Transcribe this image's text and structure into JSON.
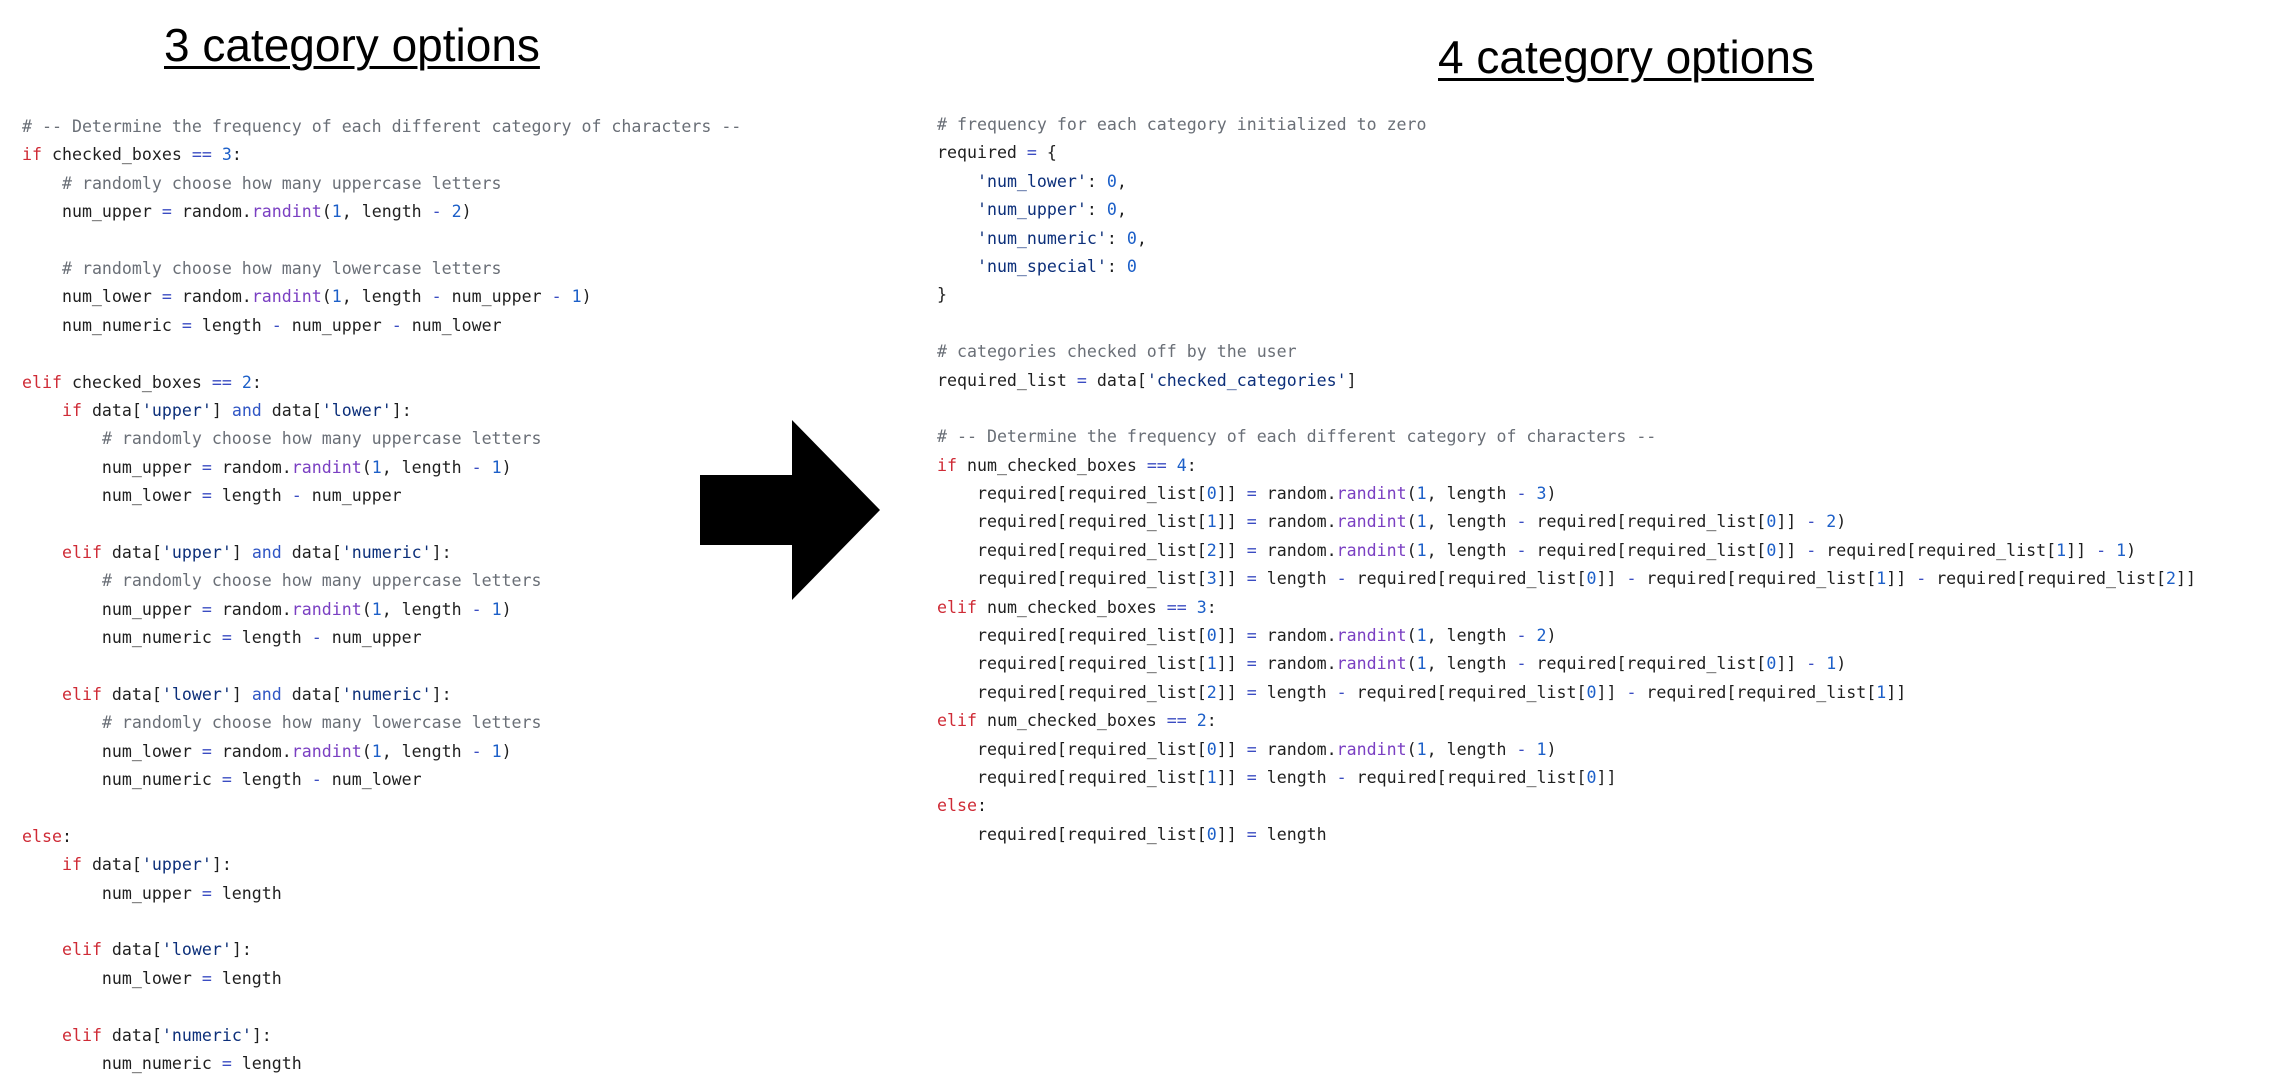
{
  "headings": {
    "left": "3 category options",
    "right": "4 category options"
  },
  "colors": {
    "comment": "#6a6f77",
    "keyword": "#cf2b36",
    "keyword2": "#2f55c4",
    "func": "#7a3fc2",
    "number": "#1c5fc8",
    "string": "#0c2f7a",
    "op": "#3a4cc2",
    "plain": "#1f1f1f",
    "arrow": "#000000"
  },
  "arrow": {
    "icon": "right-arrow-icon"
  },
  "code_left": [
    [
      [
        "c",
        "# -- Determine the frequency of each different category of characters --"
      ]
    ],
    [
      [
        "k",
        "if"
      ],
      [
        "p",
        " checked_boxes "
      ],
      [
        "o",
        "=="
      ],
      [
        "p",
        " "
      ],
      [
        "n",
        "3"
      ],
      [
        "p",
        ":"
      ]
    ],
    [
      [
        "p",
        "    "
      ],
      [
        "c",
        "# randomly choose how many uppercase letters"
      ]
    ],
    [
      [
        "p",
        "    num_upper "
      ],
      [
        "o",
        "="
      ],
      [
        "p",
        " random."
      ],
      [
        "f",
        "randint"
      ],
      [
        "p",
        "("
      ],
      [
        "n",
        "1"
      ],
      [
        "p",
        ", length "
      ],
      [
        "o",
        "-"
      ],
      [
        "p",
        " "
      ],
      [
        "n",
        "2"
      ],
      [
        "p",
        ")"
      ]
    ],
    [],
    [
      [
        "p",
        "    "
      ],
      [
        "c",
        "# randomly choose how many lowercase letters"
      ]
    ],
    [
      [
        "p",
        "    num_lower "
      ],
      [
        "o",
        "="
      ],
      [
        "p",
        " random."
      ],
      [
        "f",
        "randint"
      ],
      [
        "p",
        "("
      ],
      [
        "n",
        "1"
      ],
      [
        "p",
        ", length "
      ],
      [
        "o",
        "-"
      ],
      [
        "p",
        " num_upper "
      ],
      [
        "o",
        "-"
      ],
      [
        "p",
        " "
      ],
      [
        "n",
        "1"
      ],
      [
        "p",
        ")"
      ]
    ],
    [
      [
        "p",
        "    num_numeric "
      ],
      [
        "o",
        "="
      ],
      [
        "p",
        " length "
      ],
      [
        "o",
        "-"
      ],
      [
        "p",
        " num_upper "
      ],
      [
        "o",
        "-"
      ],
      [
        "p",
        " num_lower"
      ]
    ],
    [],
    [
      [
        "k",
        "elif"
      ],
      [
        "p",
        " checked_boxes "
      ],
      [
        "o",
        "=="
      ],
      [
        "p",
        " "
      ],
      [
        "n",
        "2"
      ],
      [
        "p",
        ":"
      ]
    ],
    [
      [
        "p",
        "    "
      ],
      [
        "k",
        "if"
      ],
      [
        "p",
        " data["
      ],
      [
        "s",
        "'upper'"
      ],
      [
        "p",
        "] "
      ],
      [
        "w",
        "and"
      ],
      [
        "p",
        " data["
      ],
      [
        "s",
        "'lower'"
      ],
      [
        "p",
        "]:"
      ]
    ],
    [
      [
        "p",
        "        "
      ],
      [
        "c",
        "# randomly choose how many uppercase letters"
      ]
    ],
    [
      [
        "p",
        "        num_upper "
      ],
      [
        "o",
        "="
      ],
      [
        "p",
        " random."
      ],
      [
        "f",
        "randint"
      ],
      [
        "p",
        "("
      ],
      [
        "n",
        "1"
      ],
      [
        "p",
        ", length "
      ],
      [
        "o",
        "-"
      ],
      [
        "p",
        " "
      ],
      [
        "n",
        "1"
      ],
      [
        "p",
        ")"
      ]
    ],
    [
      [
        "p",
        "        num_lower "
      ],
      [
        "o",
        "="
      ],
      [
        "p",
        " length "
      ],
      [
        "o",
        "-"
      ],
      [
        "p",
        " num_upper"
      ]
    ],
    [],
    [
      [
        "p",
        "    "
      ],
      [
        "k",
        "elif"
      ],
      [
        "p",
        " data["
      ],
      [
        "s",
        "'upper'"
      ],
      [
        "p",
        "] "
      ],
      [
        "w",
        "and"
      ],
      [
        "p",
        " data["
      ],
      [
        "s",
        "'numeric'"
      ],
      [
        "p",
        "]:"
      ]
    ],
    [
      [
        "p",
        "        "
      ],
      [
        "c",
        "# randomly choose how many uppercase letters"
      ]
    ],
    [
      [
        "p",
        "        num_upper "
      ],
      [
        "o",
        "="
      ],
      [
        "p",
        " random."
      ],
      [
        "f",
        "randint"
      ],
      [
        "p",
        "("
      ],
      [
        "n",
        "1"
      ],
      [
        "p",
        ", length "
      ],
      [
        "o",
        "-"
      ],
      [
        "p",
        " "
      ],
      [
        "n",
        "1"
      ],
      [
        "p",
        ")"
      ]
    ],
    [
      [
        "p",
        "        num_numeric "
      ],
      [
        "o",
        "="
      ],
      [
        "p",
        " length "
      ],
      [
        "o",
        "-"
      ],
      [
        "p",
        " num_upper"
      ]
    ],
    [],
    [
      [
        "p",
        "    "
      ],
      [
        "k",
        "elif"
      ],
      [
        "p",
        " data["
      ],
      [
        "s",
        "'lower'"
      ],
      [
        "p",
        "] "
      ],
      [
        "w",
        "and"
      ],
      [
        "p",
        " data["
      ],
      [
        "s",
        "'numeric'"
      ],
      [
        "p",
        "]:"
      ]
    ],
    [
      [
        "p",
        "        "
      ],
      [
        "c",
        "# randomly choose how many lowercase letters"
      ]
    ],
    [
      [
        "p",
        "        num_lower "
      ],
      [
        "o",
        "="
      ],
      [
        "p",
        " random."
      ],
      [
        "f",
        "randint"
      ],
      [
        "p",
        "("
      ],
      [
        "n",
        "1"
      ],
      [
        "p",
        ", length "
      ],
      [
        "o",
        "-"
      ],
      [
        "p",
        " "
      ],
      [
        "n",
        "1"
      ],
      [
        "p",
        ")"
      ]
    ],
    [
      [
        "p",
        "        num_numeric "
      ],
      [
        "o",
        "="
      ],
      [
        "p",
        " length "
      ],
      [
        "o",
        "-"
      ],
      [
        "p",
        " num_lower"
      ]
    ],
    [],
    [
      [
        "k",
        "else"
      ],
      [
        "p",
        ":"
      ]
    ],
    [
      [
        "p",
        "    "
      ],
      [
        "k",
        "if"
      ],
      [
        "p",
        " data["
      ],
      [
        "s",
        "'upper'"
      ],
      [
        "p",
        "]:"
      ]
    ],
    [
      [
        "p",
        "        num_upper "
      ],
      [
        "o",
        "="
      ],
      [
        "p",
        " length"
      ]
    ],
    [],
    [
      [
        "p",
        "    "
      ],
      [
        "k",
        "elif"
      ],
      [
        "p",
        " data["
      ],
      [
        "s",
        "'lower'"
      ],
      [
        "p",
        "]:"
      ]
    ],
    [
      [
        "p",
        "        num_lower "
      ],
      [
        "o",
        "="
      ],
      [
        "p",
        " length"
      ]
    ],
    [],
    [
      [
        "p",
        "    "
      ],
      [
        "k",
        "elif"
      ],
      [
        "p",
        " data["
      ],
      [
        "s",
        "'numeric'"
      ],
      [
        "p",
        "]:"
      ]
    ],
    [
      [
        "p",
        "        num_numeric "
      ],
      [
        "o",
        "="
      ],
      [
        "p",
        " length"
      ]
    ]
  ],
  "code_right": [
    [
      [
        "c",
        "# frequency for each category initialized to zero"
      ]
    ],
    [
      [
        "p",
        "required "
      ],
      [
        "o",
        "="
      ],
      [
        "p",
        " {"
      ]
    ],
    [
      [
        "p",
        "    "
      ],
      [
        "s",
        "'num_lower'"
      ],
      [
        "p",
        ": "
      ],
      [
        "n",
        "0"
      ],
      [
        "p",
        ","
      ]
    ],
    [
      [
        "p",
        "    "
      ],
      [
        "s",
        "'num_upper'"
      ],
      [
        "p",
        ": "
      ],
      [
        "n",
        "0"
      ],
      [
        "p",
        ","
      ]
    ],
    [
      [
        "p",
        "    "
      ],
      [
        "s",
        "'num_numeric'"
      ],
      [
        "p",
        ": "
      ],
      [
        "n",
        "0"
      ],
      [
        "p",
        ","
      ]
    ],
    [
      [
        "p",
        "    "
      ],
      [
        "s",
        "'num_special'"
      ],
      [
        "p",
        ": "
      ],
      [
        "n",
        "0"
      ]
    ],
    [
      [
        "p",
        "}"
      ]
    ],
    [],
    [
      [
        "c",
        "# categories checked off by the user"
      ]
    ],
    [
      [
        "p",
        "required_list "
      ],
      [
        "o",
        "="
      ],
      [
        "p",
        " data["
      ],
      [
        "s",
        "'checked_categories'"
      ],
      [
        "p",
        "]"
      ]
    ],
    [],
    [
      [
        "c",
        "# -- Determine the frequency of each different category of characters --"
      ]
    ],
    [
      [
        "k",
        "if"
      ],
      [
        "p",
        " num_checked_boxes "
      ],
      [
        "o",
        "=="
      ],
      [
        "p",
        " "
      ],
      [
        "n",
        "4"
      ],
      [
        "p",
        ":"
      ]
    ],
    [
      [
        "p",
        "    required[required_list["
      ],
      [
        "n",
        "0"
      ],
      [
        "p",
        "]] "
      ],
      [
        "o",
        "="
      ],
      [
        "p",
        " random."
      ],
      [
        "f",
        "randint"
      ],
      [
        "p",
        "("
      ],
      [
        "n",
        "1"
      ],
      [
        "p",
        ", length "
      ],
      [
        "o",
        "-"
      ],
      [
        "p",
        " "
      ],
      [
        "n",
        "3"
      ],
      [
        "p",
        ")"
      ]
    ],
    [
      [
        "p",
        "    required[required_list["
      ],
      [
        "n",
        "1"
      ],
      [
        "p",
        "]] "
      ],
      [
        "o",
        "="
      ],
      [
        "p",
        " random."
      ],
      [
        "f",
        "randint"
      ],
      [
        "p",
        "("
      ],
      [
        "n",
        "1"
      ],
      [
        "p",
        ", length "
      ],
      [
        "o",
        "-"
      ],
      [
        "p",
        " required[required_list["
      ],
      [
        "n",
        "0"
      ],
      [
        "p",
        "]] "
      ],
      [
        "o",
        "-"
      ],
      [
        "p",
        " "
      ],
      [
        "n",
        "2"
      ],
      [
        "p",
        ")"
      ]
    ],
    [
      [
        "p",
        "    required[required_list["
      ],
      [
        "n",
        "2"
      ],
      [
        "p",
        "]] "
      ],
      [
        "o",
        "="
      ],
      [
        "p",
        " random."
      ],
      [
        "f",
        "randint"
      ],
      [
        "p",
        "("
      ],
      [
        "n",
        "1"
      ],
      [
        "p",
        ", length "
      ],
      [
        "o",
        "-"
      ],
      [
        "p",
        " required[required_list["
      ],
      [
        "n",
        "0"
      ],
      [
        "p",
        "]] "
      ],
      [
        "o",
        "-"
      ],
      [
        "p",
        " required[required_list["
      ],
      [
        "n",
        "1"
      ],
      [
        "p",
        "]] "
      ],
      [
        "o",
        "-"
      ],
      [
        "p",
        " "
      ],
      [
        "n",
        "1"
      ],
      [
        "p",
        ")"
      ]
    ],
    [
      [
        "p",
        "    required[required_list["
      ],
      [
        "n",
        "3"
      ],
      [
        "p",
        "]] "
      ],
      [
        "o",
        "="
      ],
      [
        "p",
        " length "
      ],
      [
        "o",
        "-"
      ],
      [
        "p",
        " required[required_list["
      ],
      [
        "n",
        "0"
      ],
      [
        "p",
        "]] "
      ],
      [
        "o",
        "-"
      ],
      [
        "p",
        " required[required_list["
      ],
      [
        "n",
        "1"
      ],
      [
        "p",
        "]] "
      ],
      [
        "o",
        "-"
      ],
      [
        "p",
        " required[required_list["
      ],
      [
        "n",
        "2"
      ],
      [
        "p",
        "]]"
      ]
    ],
    [
      [
        "k",
        "elif"
      ],
      [
        "p",
        " num_checked_boxes "
      ],
      [
        "o",
        "=="
      ],
      [
        "p",
        " "
      ],
      [
        "n",
        "3"
      ],
      [
        "p",
        ":"
      ]
    ],
    [
      [
        "p",
        "    required[required_list["
      ],
      [
        "n",
        "0"
      ],
      [
        "p",
        "]] "
      ],
      [
        "o",
        "="
      ],
      [
        "p",
        " random."
      ],
      [
        "f",
        "randint"
      ],
      [
        "p",
        "("
      ],
      [
        "n",
        "1"
      ],
      [
        "p",
        ", length "
      ],
      [
        "o",
        "-"
      ],
      [
        "p",
        " "
      ],
      [
        "n",
        "2"
      ],
      [
        "p",
        ")"
      ]
    ],
    [
      [
        "p",
        "    required[required_list["
      ],
      [
        "n",
        "1"
      ],
      [
        "p",
        "]] "
      ],
      [
        "o",
        "="
      ],
      [
        "p",
        " random."
      ],
      [
        "f",
        "randint"
      ],
      [
        "p",
        "("
      ],
      [
        "n",
        "1"
      ],
      [
        "p",
        ", length "
      ],
      [
        "o",
        "-"
      ],
      [
        "p",
        " required[required_list["
      ],
      [
        "n",
        "0"
      ],
      [
        "p",
        "]] "
      ],
      [
        "o",
        "-"
      ],
      [
        "p",
        " "
      ],
      [
        "n",
        "1"
      ],
      [
        "p",
        ")"
      ]
    ],
    [
      [
        "p",
        "    required[required_list["
      ],
      [
        "n",
        "2"
      ],
      [
        "p",
        "]] "
      ],
      [
        "o",
        "="
      ],
      [
        "p",
        " length "
      ],
      [
        "o",
        "-"
      ],
      [
        "p",
        " required[required_list["
      ],
      [
        "n",
        "0"
      ],
      [
        "p",
        "]] "
      ],
      [
        "o",
        "-"
      ],
      [
        "p",
        " required[required_list["
      ],
      [
        "n",
        "1"
      ],
      [
        "p",
        "]]"
      ]
    ],
    [
      [
        "k",
        "elif"
      ],
      [
        "p",
        " num_checked_boxes "
      ],
      [
        "o",
        "=="
      ],
      [
        "p",
        " "
      ],
      [
        "n",
        "2"
      ],
      [
        "p",
        ":"
      ]
    ],
    [
      [
        "p",
        "    required[required_list["
      ],
      [
        "n",
        "0"
      ],
      [
        "p",
        "]] "
      ],
      [
        "o",
        "="
      ],
      [
        "p",
        " random."
      ],
      [
        "f",
        "randint"
      ],
      [
        "p",
        "("
      ],
      [
        "n",
        "1"
      ],
      [
        "p",
        ", length "
      ],
      [
        "o",
        "-"
      ],
      [
        "p",
        " "
      ],
      [
        "n",
        "1"
      ],
      [
        "p",
        ")"
      ]
    ],
    [
      [
        "p",
        "    required[required_list["
      ],
      [
        "n",
        "1"
      ],
      [
        "p",
        "]] "
      ],
      [
        "o",
        "="
      ],
      [
        "p",
        " length "
      ],
      [
        "o",
        "-"
      ],
      [
        "p",
        " required[required_list["
      ],
      [
        "n",
        "0"
      ],
      [
        "p",
        "]]"
      ]
    ],
    [
      [
        "k",
        "else"
      ],
      [
        "p",
        ":"
      ]
    ],
    [
      [
        "p",
        "    required[required_list["
      ],
      [
        "n",
        "0"
      ],
      [
        "p",
        "]] "
      ],
      [
        "o",
        "="
      ],
      [
        "p",
        " length"
      ]
    ]
  ]
}
